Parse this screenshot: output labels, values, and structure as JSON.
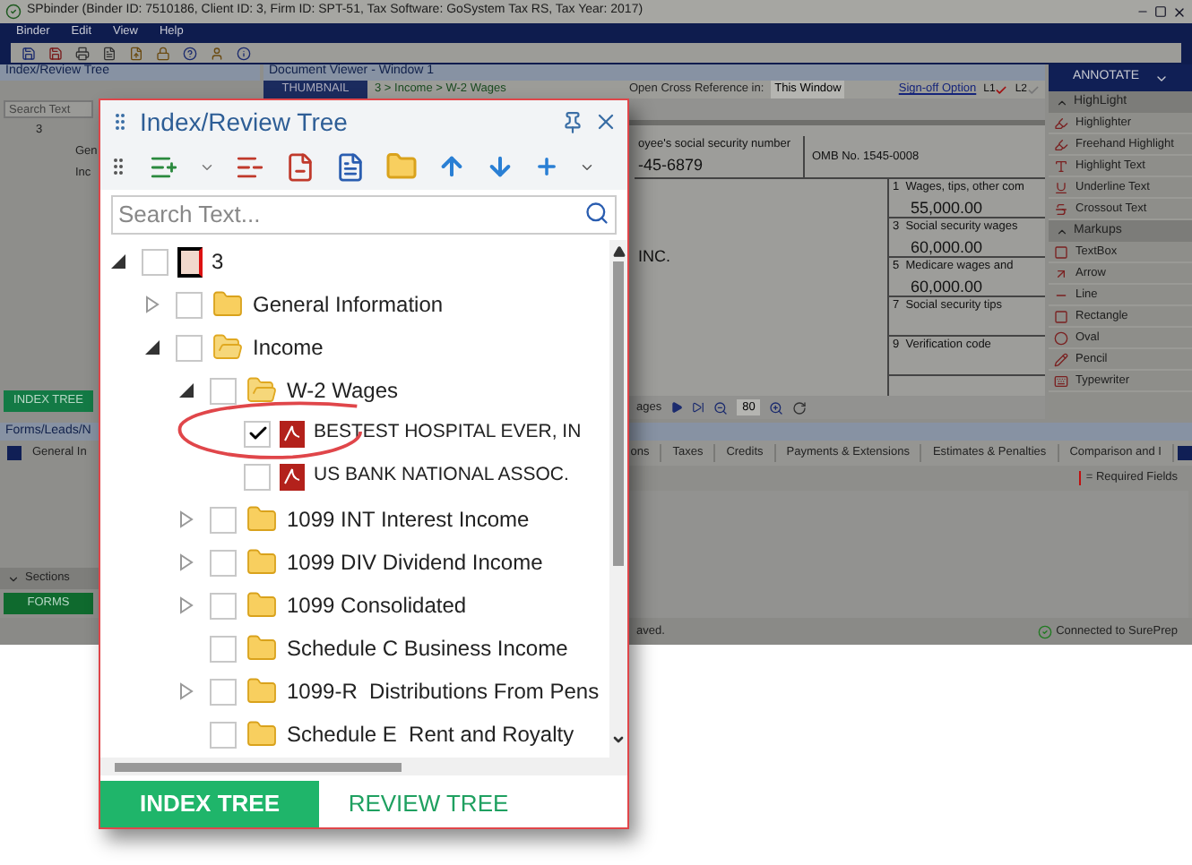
{
  "window": {
    "title": "SPbinder (Binder ID: 7510186, Client ID: 3, Firm ID: SPT-51, Tax Software: GoSystem Tax RS, Tax Year: 2017)"
  },
  "menu": [
    "Binder",
    "Edit",
    "View",
    "Help"
  ],
  "left_panel": {
    "title": "Index/Review Tree",
    "search": {
      "placeholder": "Search Text"
    },
    "tree": [
      "3",
      "Gen",
      "Inc"
    ],
    "tab": "INDEX TREE"
  },
  "viewer": {
    "title": "Document Viewer - Window 1",
    "thumbnail_tab": "THUMBNAIL",
    "breadcrumb": "3 > Income > W-2 Wages",
    "cross_ref_label": "Open Cross Reference in:",
    "cross_ref_value": "This Window",
    "signoff_link": "Sign-off Option",
    "levels": [
      {
        "label": "L1",
        "checked": true
      },
      {
        "label": "L2",
        "checked": false
      }
    ],
    "form": {
      "ssn_label": "oyee's social security number",
      "ssn": "-45-6879",
      "omb": "OMB No. 1545-0008",
      "employer": "INC.",
      "boxes": [
        {
          "label": "1  Wages, tips, other com",
          "value": "55,000.00"
        },
        {
          "label": "3  Social security wages",
          "value": "60,000.00"
        },
        {
          "label": "5  Medicare wages and",
          "value": "60,000.00"
        },
        {
          "label": "7  Social security tips"
        },
        {
          "label": "9  Verification code"
        }
      ]
    },
    "pager_label": "ages",
    "zoom": "80"
  },
  "annotate": {
    "title": "ANNOTATE",
    "groups": [
      {
        "name": "HighLight",
        "expanded": true,
        "items": [
          "Highlighter",
          "Freehand Highlight",
          "Highlight Text",
          "Underline Text",
          "Crossout Text"
        ]
      },
      {
        "name": "Markups",
        "expanded": true,
        "items": [
          "TextBox",
          "Arrow",
          "Line",
          "Rectangle",
          "Oval",
          "Pencil",
          "Typewriter"
        ]
      }
    ]
  },
  "forms_panel": {
    "title": "Forms/Leads/N",
    "first_tab": "General In",
    "sections": "Sections",
    "button": "FORMS"
  },
  "form_tabs": [
    "ons",
    "Taxes",
    "Credits",
    "Payments & Extensions",
    "Estimates & Penalties",
    "Comparison and I"
  ],
  "required_note": "= Required Fields",
  "status_bar": {
    "message": "aved.",
    "connection": "Connected to SurePrep"
  },
  "popup": {
    "title": "Index/Review Tree",
    "search": {
      "placeholder": "Search Text..."
    },
    "tree": [
      {
        "label": "3",
        "kind": "binder",
        "expandable": true,
        "expanded": true,
        "checked": false,
        "children": [
          {
            "label": "General Information",
            "kind": "folder",
            "expandable": true,
            "expanded": false,
            "checked": false
          },
          {
            "label": "Income",
            "kind": "folder",
            "expandable": true,
            "expanded": true,
            "checked": false,
            "children": [
              {
                "label": "W-2 Wages",
                "kind": "folder",
                "expandable": true,
                "expanded": true,
                "checked": false,
                "children": [
                  {
                    "label": "BESTEST HOSPITAL EVER, IN",
                    "kind": "pdf",
                    "expandable": false,
                    "checked": true
                  },
                  {
                    "label": "US BANK NATIONAL ASSOC.",
                    "kind": "pdf",
                    "expandable": false,
                    "checked": false
                  }
                ]
              },
              {
                "label": "1099 INT Interest Income",
                "kind": "folder",
                "expandable": true,
                "expanded": false,
                "checked": false
              },
              {
                "label": "1099 DIV Dividend Income",
                "kind": "folder",
                "expandable": true,
                "expanded": false,
                "checked": false
              },
              {
                "label": "1099 Consolidated",
                "kind": "folder",
                "expandable": true,
                "expanded": false,
                "checked": false
              },
              {
                "label": "Schedule C Business Income",
                "kind": "folder",
                "expandable": false,
                "checked": false
              },
              {
                "label": "1099-R  Distributions From Pens",
                "kind": "folder",
                "expandable": true,
                "expanded": false,
                "checked": false
              },
              {
                "label": "Schedule E  Rent and Royalty",
                "kind": "folder",
                "expandable": false,
                "checked": false
              }
            ]
          }
        ]
      }
    ],
    "tabs": [
      {
        "label": "INDEX TREE",
        "selected": true
      },
      {
        "label": "REVIEW TREE",
        "selected": false
      }
    ]
  }
}
